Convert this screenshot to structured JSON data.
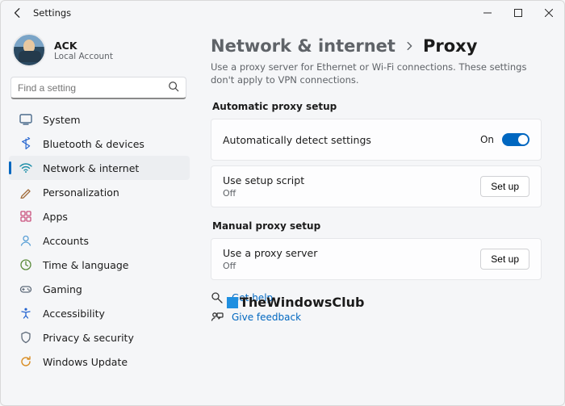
{
  "titlebar": {
    "app_title": "Settings"
  },
  "profile": {
    "name": "ACK",
    "sub": "Local Account"
  },
  "search": {
    "placeholder": "Find a setting"
  },
  "sidebar": {
    "items": [
      {
        "label": "System"
      },
      {
        "label": "Bluetooth & devices"
      },
      {
        "label": "Network & internet"
      },
      {
        "label": "Personalization"
      },
      {
        "label": "Apps"
      },
      {
        "label": "Accounts"
      },
      {
        "label": "Time & language"
      },
      {
        "label": "Gaming"
      },
      {
        "label": "Accessibility"
      },
      {
        "label": "Privacy & security"
      },
      {
        "label": "Windows Update"
      }
    ]
  },
  "breadcrumb": {
    "parent": "Network & internet",
    "current": "Proxy"
  },
  "page": {
    "description": "Use a proxy server for Ethernet or Wi-Fi connections. These settings don't apply to VPN connections."
  },
  "sections": {
    "auto": {
      "label": "Automatic proxy setup",
      "row1": {
        "title": "Automatically detect settings",
        "state": "On"
      },
      "row2": {
        "title": "Use setup script",
        "sub": "Off",
        "button": "Set up"
      }
    },
    "manual": {
      "label": "Manual proxy setup",
      "row1": {
        "title": "Use a proxy server",
        "sub": "Off",
        "button": "Set up"
      }
    }
  },
  "links": {
    "help": "Get help",
    "feedback": "Give feedback"
  },
  "watermark": "TheWindowsClub"
}
